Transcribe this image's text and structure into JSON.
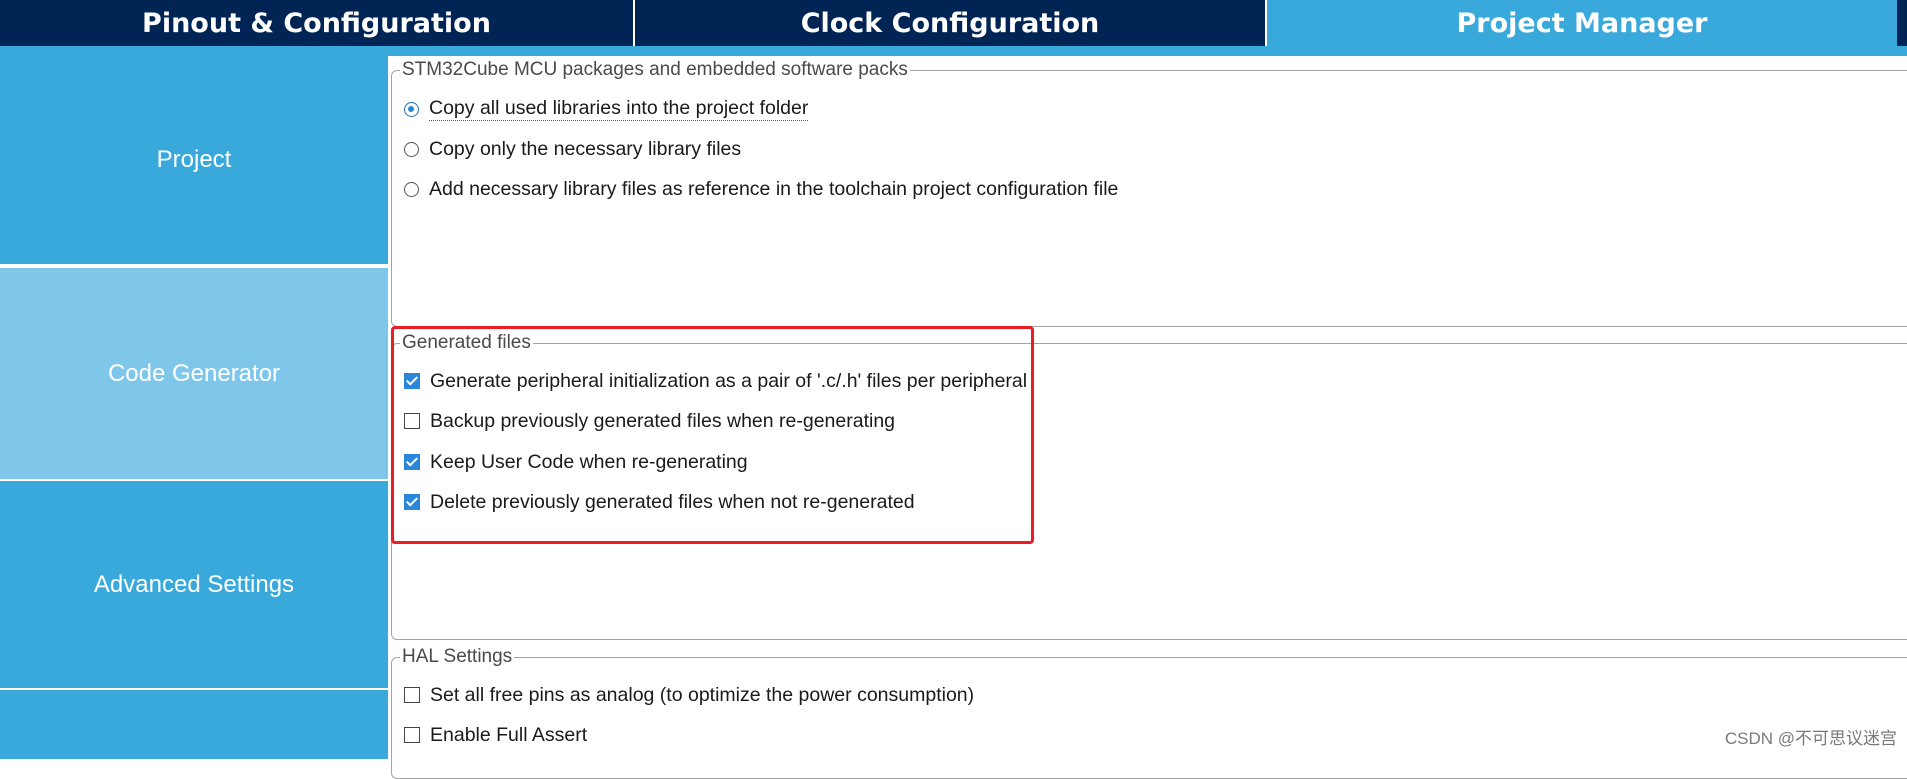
{
  "tabs": [
    {
      "label": "Pinout & Configuration",
      "active": false
    },
    {
      "label": "Clock Configuration",
      "active": false
    },
    {
      "label": "Project Manager",
      "active": true
    }
  ],
  "sidebar": {
    "items": [
      {
        "label": "Project",
        "active": false
      },
      {
        "label": "Code Generator",
        "active": true
      },
      {
        "label": "Advanced Settings",
        "active": false
      },
      {
        "label": "",
        "active": false
      }
    ]
  },
  "packages_group": {
    "title": "STM32Cube MCU packages and embedded software packs",
    "options": [
      {
        "label": "Copy all used libraries into the project folder",
        "selected": true
      },
      {
        "label": "Copy only the necessary library files",
        "selected": false
      },
      {
        "label": "Add necessary library files as reference in the toolchain project configuration file",
        "selected": false
      }
    ]
  },
  "generated_files_group": {
    "title": "Generated files",
    "options": [
      {
        "label": "Generate peripheral initialization as a pair of '.c/.h' files per peripheral",
        "checked": true
      },
      {
        "label": "Backup previously generated files when re-generating",
        "checked": false
      },
      {
        "label": "Keep User Code when re-generating",
        "checked": true
      },
      {
        "label": "Delete previously generated files when not re-generated",
        "checked": true
      }
    ]
  },
  "hal_group": {
    "title": "HAL Settings",
    "options": [
      {
        "label": "Set all free pins as analog (to optimize the power consumption)",
        "checked": false
      },
      {
        "label": "Enable Full Assert",
        "checked": false
      }
    ]
  },
  "watermark": "CSDN @不可思议迷宫",
  "colors": {
    "tabbar": "#002554",
    "accent": "#39a9dc",
    "active_nav": "#7fc7ea",
    "highlight": "#ea1c24",
    "checkbox": "#2a86d8"
  }
}
